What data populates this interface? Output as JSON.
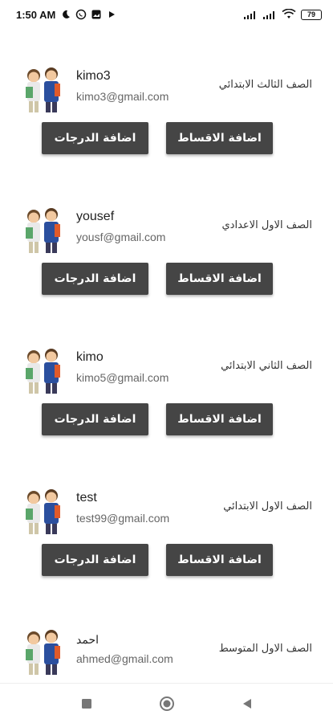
{
  "status": {
    "time": "1:50 AM",
    "icons_left": [
      "moon-icon",
      "whatsapp-icon",
      "gallery-icon",
      "play-icon"
    ],
    "icons_right": [
      "signal-icon",
      "signal-icon",
      "wifi-icon",
      "battery-icon"
    ],
    "battery": "79"
  },
  "students": [
    {
      "name": "kimo3",
      "email": "kimo3@gmail.com",
      "grade": "الصف الثالث الابتدائي",
      "grades_btn": "اضافة الدرجات",
      "installments_btn": "اضافة الاقساط"
    },
    {
      "name": "yousef",
      "email": "yousf@gmail.com",
      "grade": "الصف الاول الاعدادي",
      "grades_btn": "اضافة الدرجات",
      "installments_btn": "اضافة الاقساط"
    },
    {
      "name": "kimo",
      "email": "kimo5@gmail.com",
      "grade": "الصف الثاني الابتدائي",
      "grades_btn": "اضافة الدرجات",
      "installments_btn": "اضافة الاقساط"
    },
    {
      "name": "test",
      "email": "test99@gmail.com",
      "grade": "الصف الاول الابتدائي",
      "grades_btn": "اضافة الدرجات",
      "installments_btn": "اضافة الاقساط"
    },
    {
      "name": "احمد",
      "email": "ahmed@gmail.com",
      "grade": "الصف الاول المتوسط"
    }
  ],
  "nav": {
    "items": [
      "recents-button",
      "home-button",
      "back-button"
    ]
  }
}
